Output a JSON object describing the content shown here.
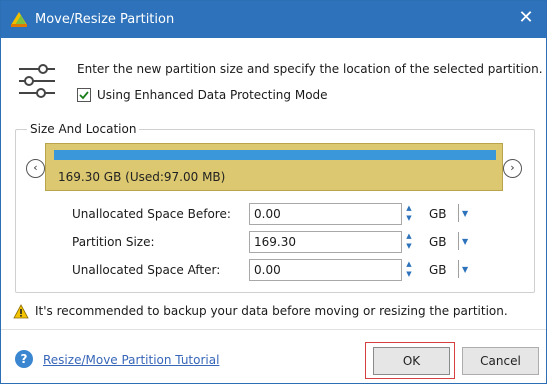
{
  "window": {
    "title": "Move/Resize Partition"
  },
  "header": {
    "instruction": "Enter the new partition size and specify the location of the selected partition.",
    "enhanced_mode_label": "Using Enhanced Data Protecting Mode",
    "enhanced_mode_checked": true
  },
  "group": {
    "label": "Size And Location"
  },
  "partition": {
    "caption": "169.30 GB (Used:97.00 MB)"
  },
  "fields": [
    {
      "label": "Unallocated Space Before:",
      "value": "0.00",
      "unit": "GB"
    },
    {
      "label": "Partition Size:",
      "value": "169.30",
      "unit": "GB"
    },
    {
      "label": "Unallocated Space After:",
      "value": "0.00",
      "unit": "GB"
    }
  ],
  "warning": "It's recommended to backup your data before moving or resizing the partition.",
  "footer": {
    "help_link": "Resize/Move Partition Tutorial",
    "ok_label": "OK",
    "cancel_label": "Cancel"
  },
  "colors": {
    "titlebar": "#2d72ba",
    "partition_bar": "#dcc870",
    "used_bar": "#3a97d9",
    "link": "#3866b8",
    "focus_outline": "#d64040"
  }
}
